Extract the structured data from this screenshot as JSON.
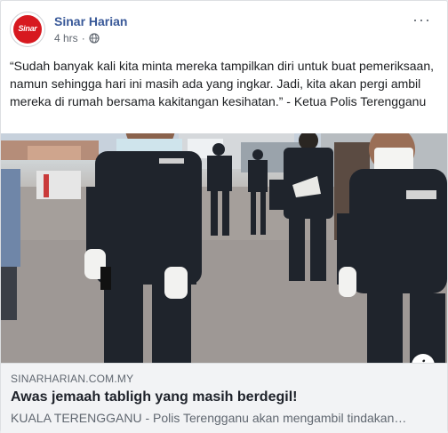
{
  "post": {
    "page_name": "Sinar Harian",
    "avatar_logo_text": "Sinar",
    "timestamp": "4 hrs",
    "separator": "·",
    "privacy_icon": "globe-icon",
    "more_icon_label": "···",
    "text": "“Sudah banyak kali kita minta mereka tampilkan diri untuk buat pemeriksaan, namun sehingga hari ini masih ada yang ingkar. Jadi, kita akan pergi ambil mereka di rumah bersama kakitangan kesihatan.” - Ketua Polis Terengganu"
  },
  "link_preview": {
    "image_icon": "info-icon",
    "info_label": "i",
    "domain": "SINARHARIAN.COM.MY",
    "title": "Awas jemaah tabligh yang masih berdegil!",
    "description": "KUALA TERENGGANU - Polis Terengganu akan mengambil tindakan…"
  },
  "colors": {
    "page_name": "#385898",
    "brand_red": "#d71920",
    "uniform": "#1f242c",
    "footer_bg": "#f2f3f5"
  }
}
